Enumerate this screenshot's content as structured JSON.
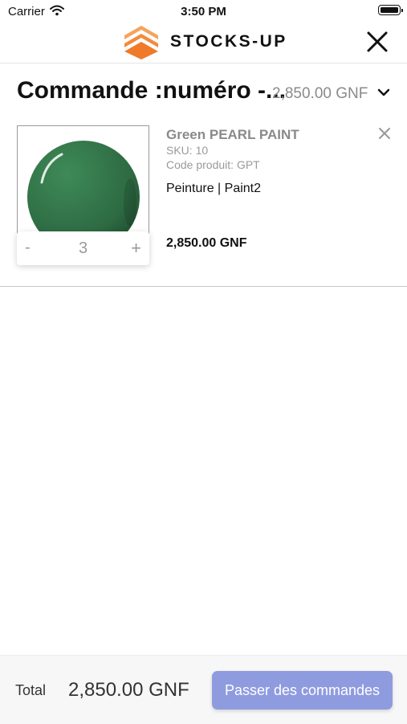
{
  "status_bar": {
    "carrier": "Carrier",
    "time": "3:50 PM"
  },
  "header": {
    "brand": "STOCKS-UP",
    "accent_color": "#F48A3A"
  },
  "order": {
    "title": "Commande :numéro -...",
    "amount": "2,850.00 GNF"
  },
  "items": [
    {
      "name": "Green PEARL PAINT",
      "sku": "SKU: 10",
      "code": "Code produit: GPT",
      "category": "Peinture | Paint2",
      "price": "2,850.00 GNF",
      "quantity": "3",
      "minus_label": "-",
      "plus_label": "+",
      "image_color": "#2E6B43"
    }
  ],
  "footer": {
    "total_label": "Total",
    "total_amount": "2,850.00 GNF",
    "submit_label": "Passer des commandes",
    "button_color": "#8F9BDF"
  }
}
